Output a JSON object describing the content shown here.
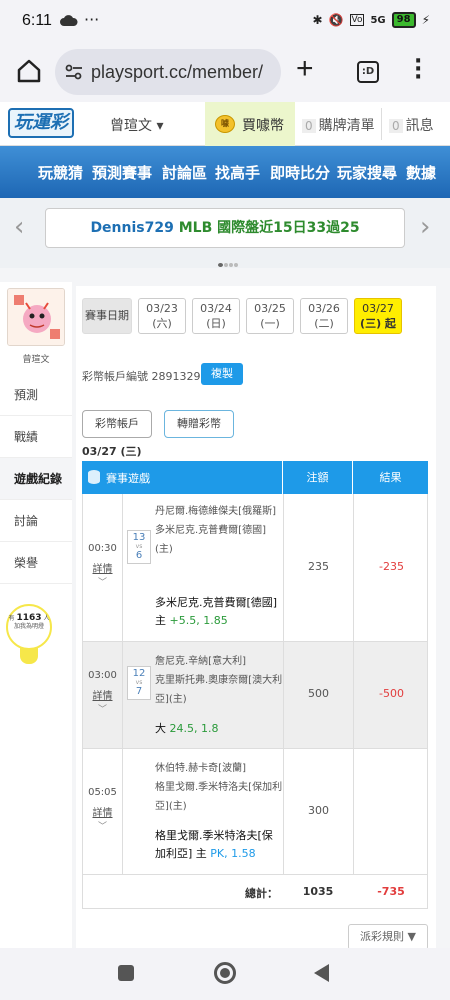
{
  "status_bar": {
    "time": "6:11",
    "dots": "···",
    "network": "5G",
    "battery": "98"
  },
  "browser": {
    "url": "playsport.cc/member/",
    "tabs_label": ":D"
  },
  "site_header": {
    "logo": "玩運彩",
    "user_name": "曾瑄文 ▾",
    "coin_label": "買噱幣",
    "coin_icon_text": "噱",
    "cart_count": "0",
    "cart_label": "購牌清單",
    "msg_count": "0",
    "msg_label": "訊息"
  },
  "main_nav": {
    "items": [
      "玩競猜",
      "預測賽事",
      "討論區",
      "找高手",
      "即時比分",
      "玩家搜尋",
      "數據"
    ]
  },
  "announcement": {
    "name": "Dennis729",
    "text": " MLB 國際盤近15日33過25"
  },
  "sidebar": {
    "avatar_caption": "曾瑄文",
    "items": [
      "預測",
      "戰績",
      "遊戲紀錄",
      "討論",
      "榮譽"
    ],
    "bulb_top": "有",
    "bulb_count": "1163",
    "bulb_unit": "人",
    "bulb_bottom": "加我為明燈"
  },
  "panel": {
    "date_label": "賽事日期",
    "dates": [
      {
        "date": "03/23",
        "day": "(六)"
      },
      {
        "date": "03/24",
        "day": "(日)"
      },
      {
        "date": "03/25",
        "day": "(一)"
      },
      {
        "date": "03/26",
        "day": "(二)"
      },
      {
        "date": "03/27",
        "day": "(三) 起"
      }
    ],
    "account_text": "彩幣帳戶編號 28913297",
    "copy_label": "複製",
    "btn_account": "彩幣帳戶",
    "btn_transfer": "轉贈彩幣",
    "date_heading": "03/27 (三)"
  },
  "table": {
    "col_game": "賽事遊戲",
    "col_amount": "注額",
    "col_result": "結果",
    "rows": [
      {
        "time": "00:30",
        "detail": "詳情",
        "vs_top": "13",
        "vs_bottom": "6",
        "team1": "丹尼爾.梅德維傑夫[俄羅斯]",
        "team2": "多米尼克.克普費爾[德國](主)",
        "bet": "多米尼克.克普費爾[德國]主 ",
        "odds": "+5.5, 1.85",
        "amount": "235",
        "result": "-235"
      },
      {
        "time": "03:00",
        "detail": "詳情",
        "vs_top": "12",
        "vs_bottom": "7",
        "team1": "詹尼克.辛納[意大利]",
        "team2": "克里斯托弗.奧康奈爾[澳大利亞](主)",
        "bet": "大 ",
        "odds": "24.5, 1.8",
        "amount": "500",
        "result": "-500"
      },
      {
        "time": "05:05",
        "detail": "詳情",
        "vs_top": "",
        "vs_bottom": "",
        "team1": "休伯特.赫卡奇[波蘭]",
        "team2": "格里戈爾.季米特洛夫[保加利亞](主)",
        "bet": "格里戈爾.季米特洛夫[保加利亞] 主 ",
        "odds": "PK, 1.58",
        "amount": "300",
        "result": ""
      }
    ],
    "total_label": "總計：",
    "total_amount": "1035",
    "total_result": "-735"
  },
  "rules_label": "派彩規則 ▼",
  "colors": {
    "brand_blue": "#1e67b4",
    "table_header": "#1e9ae8",
    "loss_red": "#e23d3d",
    "active_date": "#ffee00"
  }
}
